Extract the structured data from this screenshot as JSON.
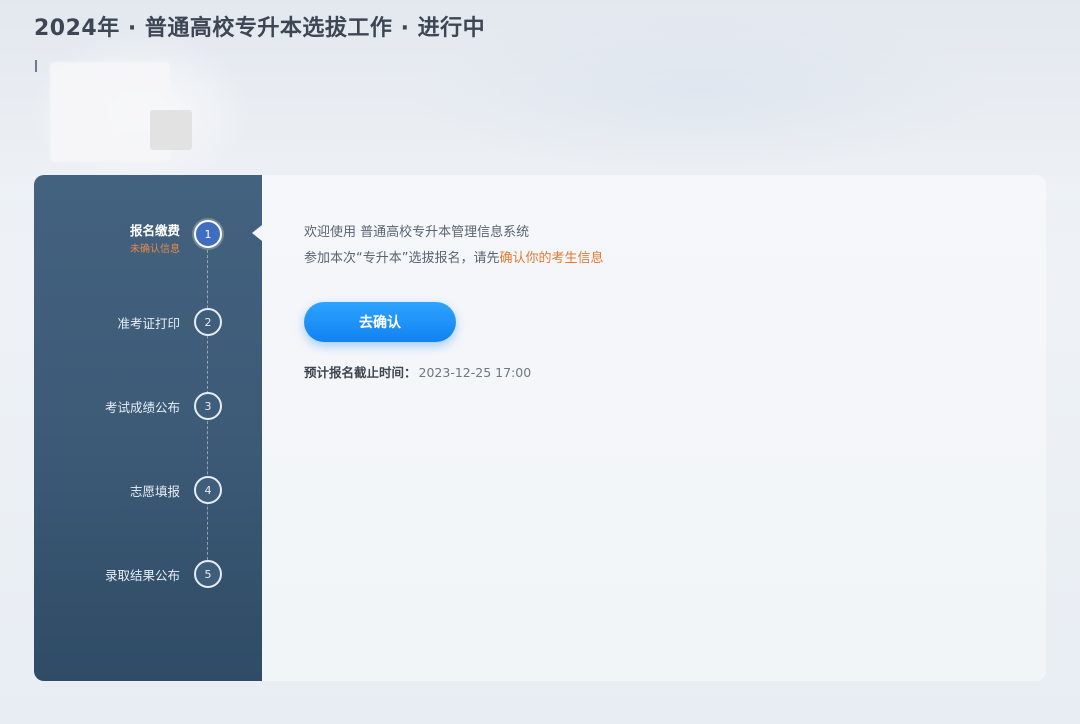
{
  "page": {
    "title": "2024年 · 普通高校专升本选拔工作 · 进行中"
  },
  "steps": [
    {
      "label": "报名缴费",
      "sub": "未确认信息",
      "number": "1",
      "active": true
    },
    {
      "label": "准考证打印",
      "number": "2",
      "active": false
    },
    {
      "label": "考试成绩公布",
      "number": "3",
      "active": false
    },
    {
      "label": "志愿填报",
      "number": "4",
      "active": false
    },
    {
      "label": "录取结果公布",
      "number": "5",
      "active": false
    }
  ],
  "content": {
    "welcome": "欢迎使用 普通高校专升本管理信息系统",
    "instruction_prefix": "参加本次“专升本”选拔报名，请先",
    "instruction_highlight": "确认你的考生信息",
    "confirm_button": "去确认",
    "deadline_label": "预计报名截止时间：",
    "deadline_value": "2023-12-25 17:00"
  },
  "colors": {
    "sidebar_top": "#43627f",
    "sidebar_bottom": "#2f4b66",
    "accent_orange": "#e07a34",
    "button_blue": "#1182f0"
  }
}
